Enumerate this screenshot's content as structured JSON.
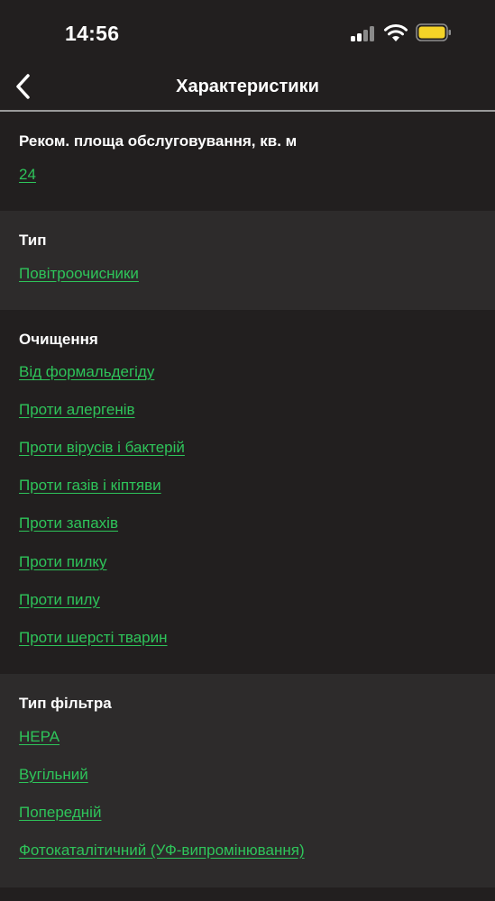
{
  "status": {
    "time": "14:56"
  },
  "nav": {
    "title": "Характеристики",
    "back_icon": "chevron-left-icon"
  },
  "sections": [
    {
      "title": "Реком. площа обслуговування, кв. м",
      "values": [
        "24"
      ]
    },
    {
      "title": "Тип",
      "values": [
        "Повітроочисники"
      ]
    },
    {
      "title": "Очищення",
      "values": [
        "Від формальдегіду",
        "Проти алергенів",
        "Проти вірусів і бактерій",
        "Проти газів і кіптяви",
        "Проти запахів",
        "Проти пилку",
        "Проти пилу",
        "Проти шерсті тварин"
      ]
    },
    {
      "title": "Тип фільтра",
      "values": [
        "HEPA",
        "Вугільний",
        "Попередній",
        "Фотокаталітичний (УФ-випромінювання)"
      ]
    }
  ],
  "colors": {
    "background": "#221f1f",
    "section_alt": "#2d2b2b",
    "link": "#2ec45a",
    "battery": "#f5d327"
  }
}
